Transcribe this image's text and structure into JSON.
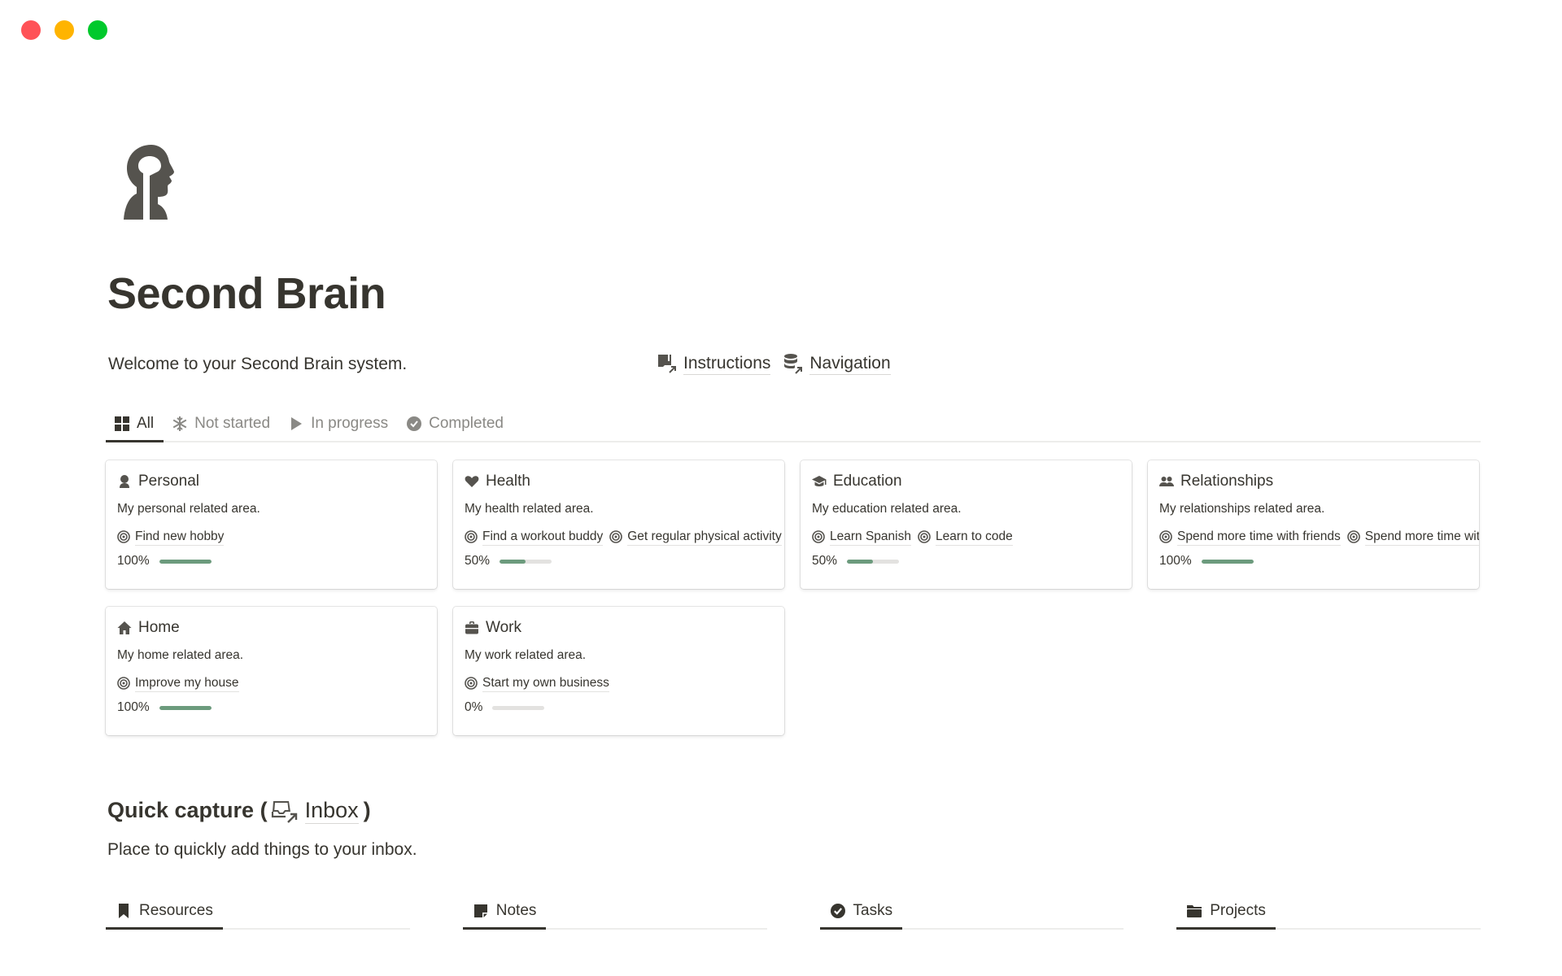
{
  "window": {
    "controls": [
      "close",
      "minimize",
      "maximize"
    ]
  },
  "page": {
    "icon": "head-brain-icon",
    "title": "Second Brain",
    "welcome": "Welcome to your Second Brain system.",
    "links": [
      {
        "label": "Instructions",
        "icon": "document-link-icon"
      },
      {
        "label": "Navigation",
        "icon": "database-link-icon"
      }
    ]
  },
  "filter_tabs": [
    {
      "label": "All",
      "icon": "grid-icon",
      "active": true
    },
    {
      "label": "Not started",
      "icon": "snowflake-icon",
      "active": false
    },
    {
      "label": "In progress",
      "icon": "play-icon",
      "active": false
    },
    {
      "label": "Completed",
      "icon": "check-circle-icon",
      "active": false
    }
  ],
  "areas": [
    {
      "name": "Personal",
      "icon": "person-icon",
      "description": "My personal related area.",
      "goals": [
        "Find new hobby"
      ],
      "progress_label": "100%",
      "progress": 1.0
    },
    {
      "name": "Health",
      "icon": "heart-icon",
      "description": "My health related area.",
      "goals": [
        "Find a workout buddy",
        "Get regular physical activity"
      ],
      "progress_label": "50%",
      "progress": 0.5
    },
    {
      "name": "Education",
      "icon": "graduation-cap-icon",
      "description": "My education related area.",
      "goals": [
        "Learn Spanish",
        "Learn to code"
      ],
      "progress_label": "50%",
      "progress": 0.5
    },
    {
      "name": "Relationships",
      "icon": "people-icon",
      "description": "My relationships related area.",
      "goals": [
        "Spend more time with friends",
        "Spend more time with family"
      ],
      "progress_label": "100%",
      "progress": 1.0
    },
    {
      "name": "Home",
      "icon": "house-icon",
      "description": "My home related area.",
      "goals": [
        "Improve my house"
      ],
      "progress_label": "100%",
      "progress": 1.0
    },
    {
      "name": "Work",
      "icon": "briefcase-icon",
      "description": "My work related area.",
      "goals": [
        "Start my own business"
      ],
      "progress_label": "0%",
      "progress": 0.0
    }
  ],
  "quick_capture": {
    "heading_prefix": "Quick capture (",
    "inbox_label": "Inbox",
    "heading_suffix": ")",
    "description": "Place to quickly add things to your inbox."
  },
  "bottom_tabs": [
    {
      "label": "Resources",
      "icon": "bookmark-icon"
    },
    {
      "label": "Notes",
      "icon": "note-icon"
    },
    {
      "label": "Tasks",
      "icon": "check-circle-icon"
    },
    {
      "label": "Projects",
      "icon": "folder-icon"
    }
  ],
  "colors": {
    "text": "#37352f",
    "muted": "#8a8985",
    "progress_fill": "#6c9b7d",
    "progress_track": "#e3e2e0"
  }
}
